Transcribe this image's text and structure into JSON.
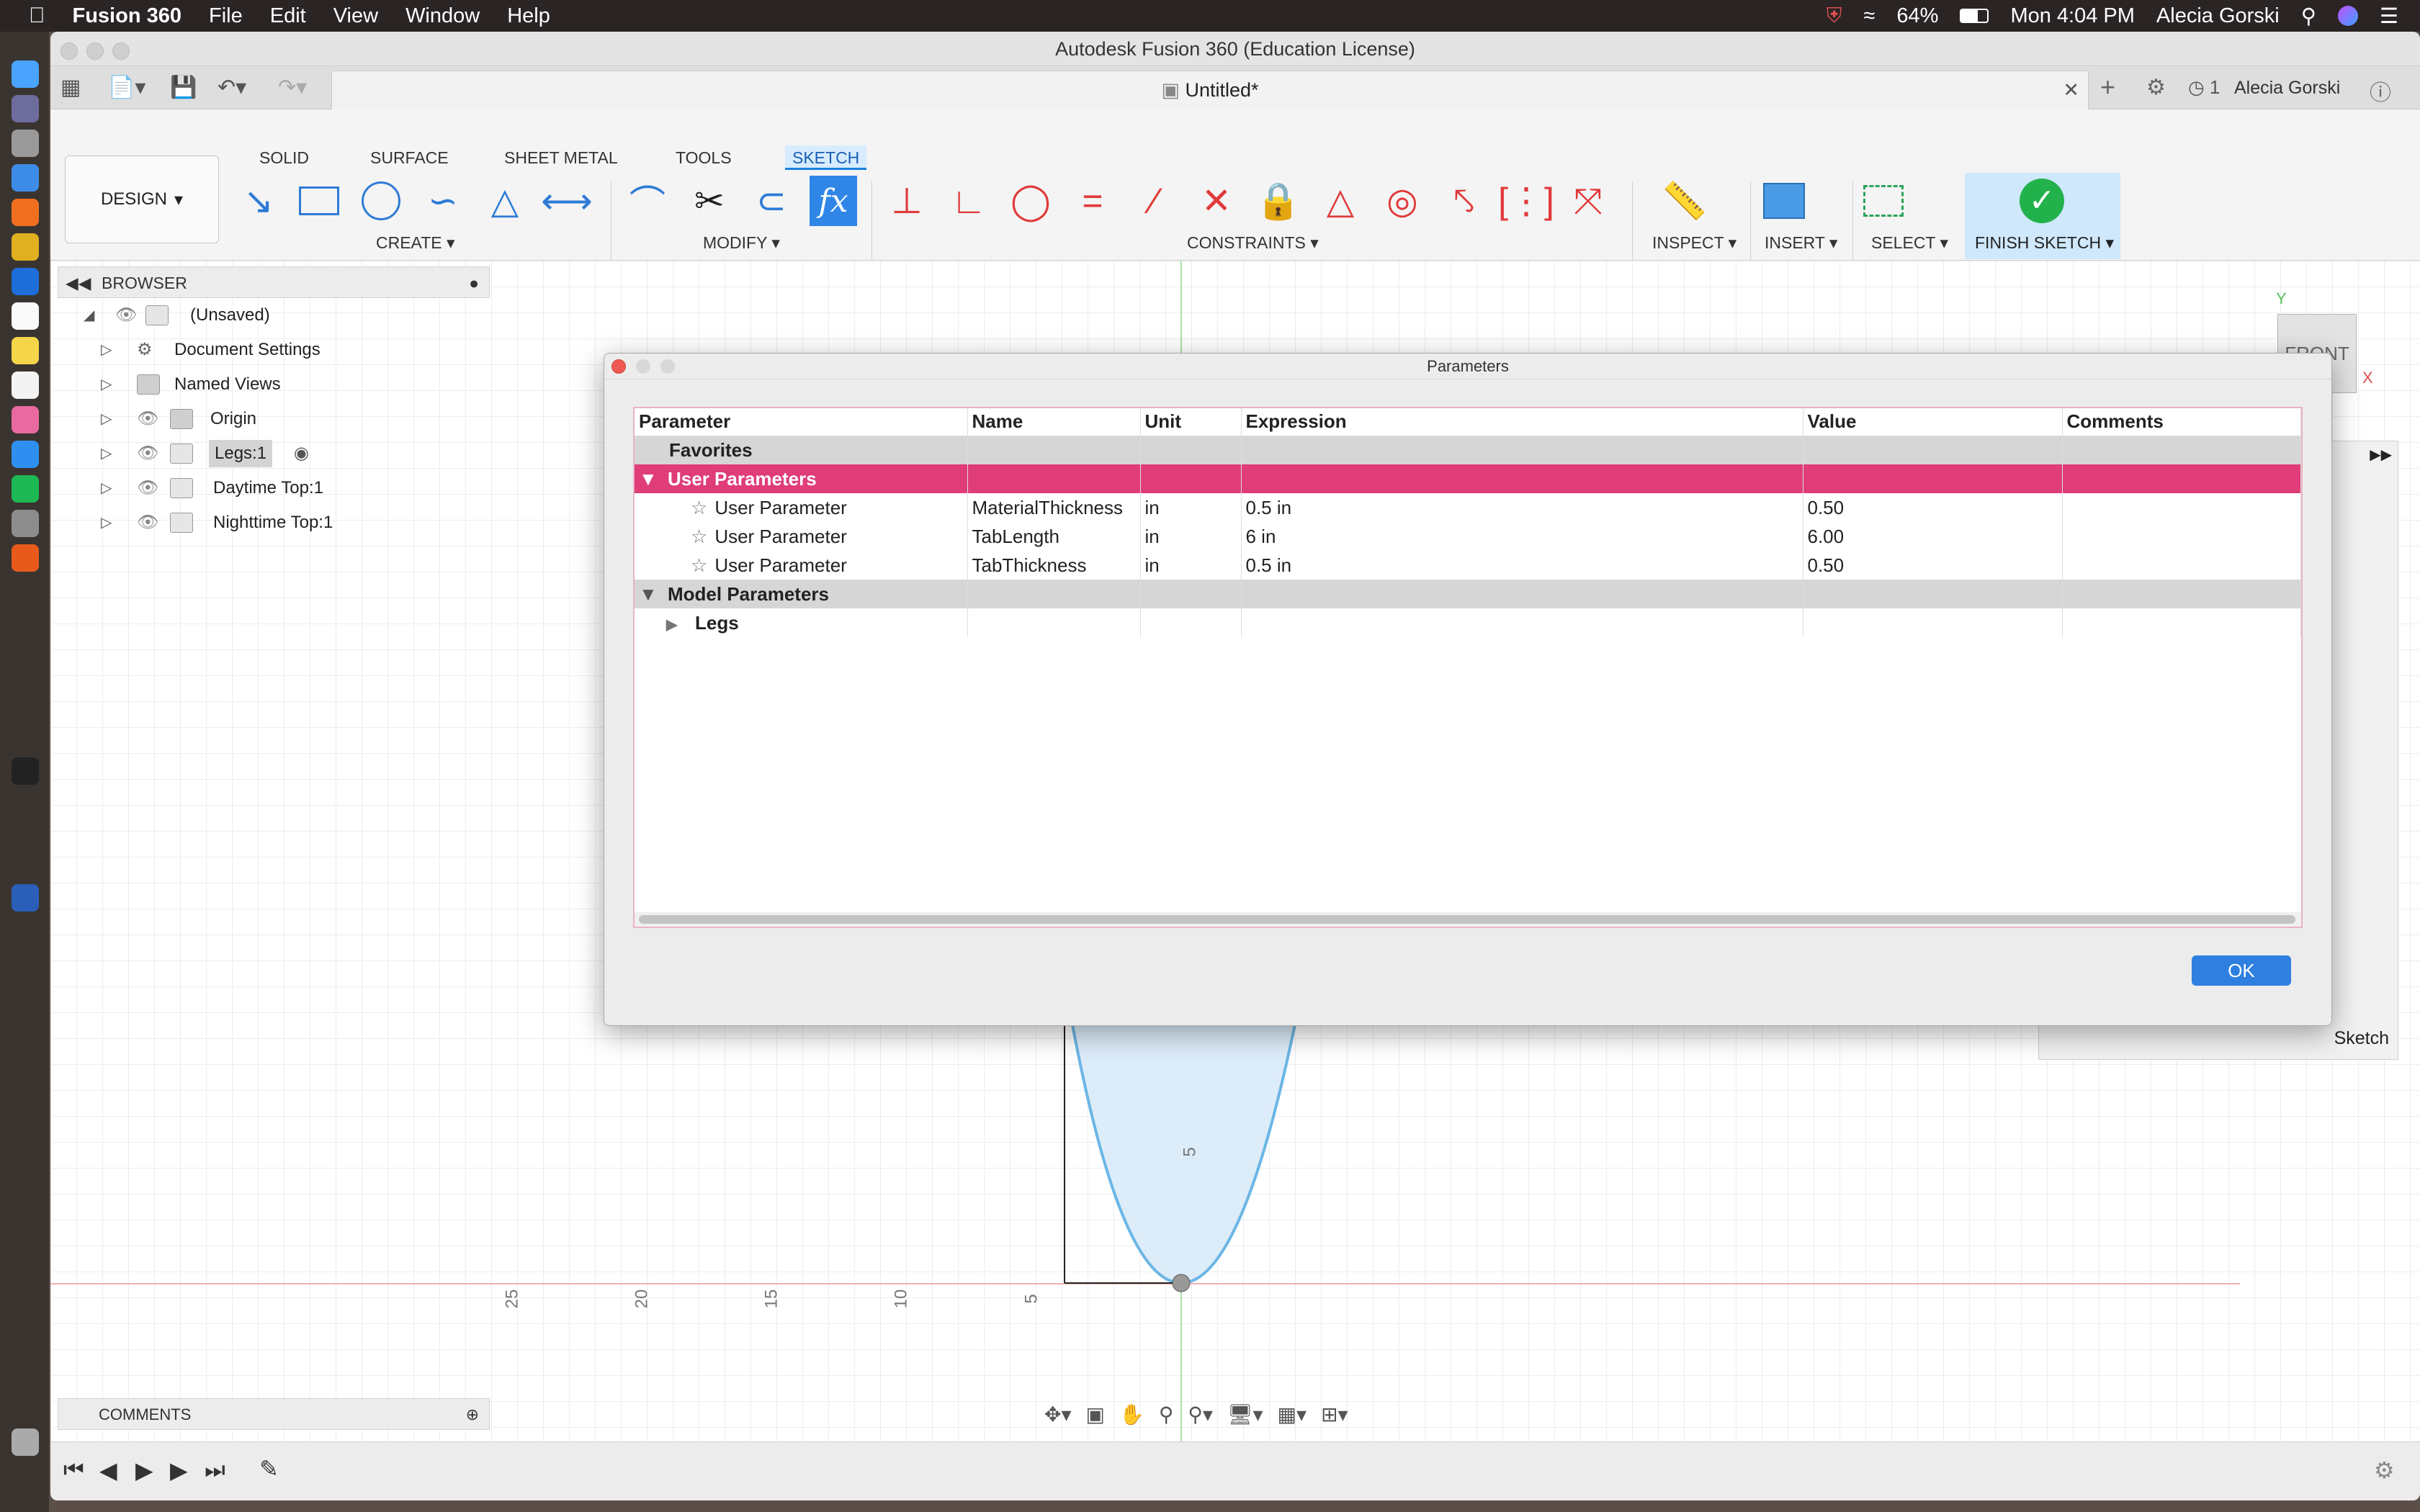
{
  "menubar": {
    "app_name": "Fusion 360",
    "menus": [
      "File",
      "Edit",
      "View",
      "Window",
      "Help"
    ],
    "battery": "64%",
    "clock": "Mon 4:04 PM",
    "user": "Alecia Gorski"
  },
  "window": {
    "title": "Autodesk Fusion 360 (Education License)",
    "doc_tab": "Untitled*",
    "job_count": "1",
    "user": "Alecia Gorski"
  },
  "ribbon": {
    "workspace": "DESIGN",
    "tabs": [
      "SOLID",
      "SURFACE",
      "SHEET METAL",
      "TOOLS",
      "SKETCH"
    ],
    "active_tab": "SKETCH",
    "groups": {
      "create": "CREATE",
      "modify": "MODIFY",
      "constraints": "CONSTRAINTS",
      "inspect": "INSPECT",
      "insert": "INSERT",
      "select": "SELECT",
      "finish": "FINISH SKETCH"
    }
  },
  "browser": {
    "title": "BROWSER",
    "root": "(Unsaved)",
    "items": [
      "Document Settings",
      "Named Views",
      "Origin",
      "Legs:1",
      "Daytime Top:1",
      "Nighttime Top:1"
    ]
  },
  "comments_label": "COMMENTS",
  "viewcube": {
    "face": "FRONT",
    "axis_y": "Y",
    "axis_x": "X"
  },
  "sketch_palette_label": "Sketch",
  "axis_ticks": [
    "25",
    "20",
    "15",
    "10",
    "5",
    "5"
  ],
  "dialog": {
    "title": "Parameters",
    "columns": [
      "Parameter",
      "Name",
      "Unit",
      "Expression",
      "Value",
      "Comments"
    ],
    "favorites_label": "Favorites",
    "user_group_label": "User Parameters",
    "user_parameters": [
      {
        "parameter": "User Parameter",
        "name": "MaterialThickness",
        "unit": "in",
        "expression": "0.5 in",
        "value": "0.50",
        "comment": ""
      },
      {
        "parameter": "User Parameter",
        "name": "TabLength",
        "unit": "in",
        "expression": "6 in",
        "value": "6.00",
        "comment": ""
      },
      {
        "parameter": "User Parameter",
        "name": "TabThickness",
        "unit": "in",
        "expression": "0.5 in",
        "value": "0.50",
        "comment": ""
      }
    ],
    "model_group_label": "Model Parameters",
    "model_children": [
      "Legs"
    ],
    "ok_label": "OK"
  },
  "colors": {
    "selected_row": "#df3c78",
    "accent": "#2f7fe0",
    "finish_check": "#22b24c"
  }
}
